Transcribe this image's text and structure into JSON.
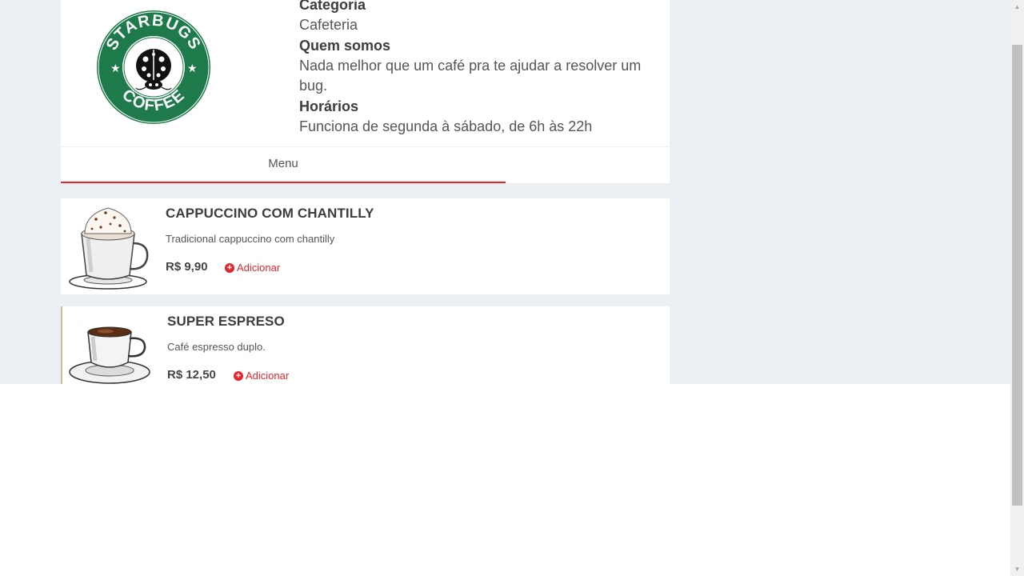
{
  "restaurant": {
    "logo": {
      "top_text": "STARBUGS",
      "bottom_text": "COFFEE",
      "colors": {
        "ring": "#00704a",
        "center": "#ffffff",
        "text": "#ffffff"
      }
    },
    "info": [
      {
        "label": "Categoria",
        "value": "Cafeteria"
      },
      {
        "label": "Quem somos",
        "value": "Nada melhor que um café pra te ajudar a resolver um bug."
      },
      {
        "label": "Horários",
        "value": "Funciona de segunda à sábado, de 6h às 22h"
      }
    ]
  },
  "tabs": [
    {
      "label": "Menu",
      "active": true
    }
  ],
  "menu": {
    "items": [
      {
        "name": "CAPPUCCINO COM CHANTILLY",
        "description": "Tradicional cappuccino com chantilly",
        "price": "R$ 9,90",
        "add_label": "Adicionar"
      },
      {
        "name": "SUPER ESPRESO",
        "description": "Café espresso duplo.",
        "price": "R$ 12,50",
        "add_label": "Adicionar"
      }
    ]
  },
  "icons": {
    "add": "plus-circle-icon"
  },
  "colors": {
    "accent": "#e5262d",
    "background": "#eceff3"
  }
}
